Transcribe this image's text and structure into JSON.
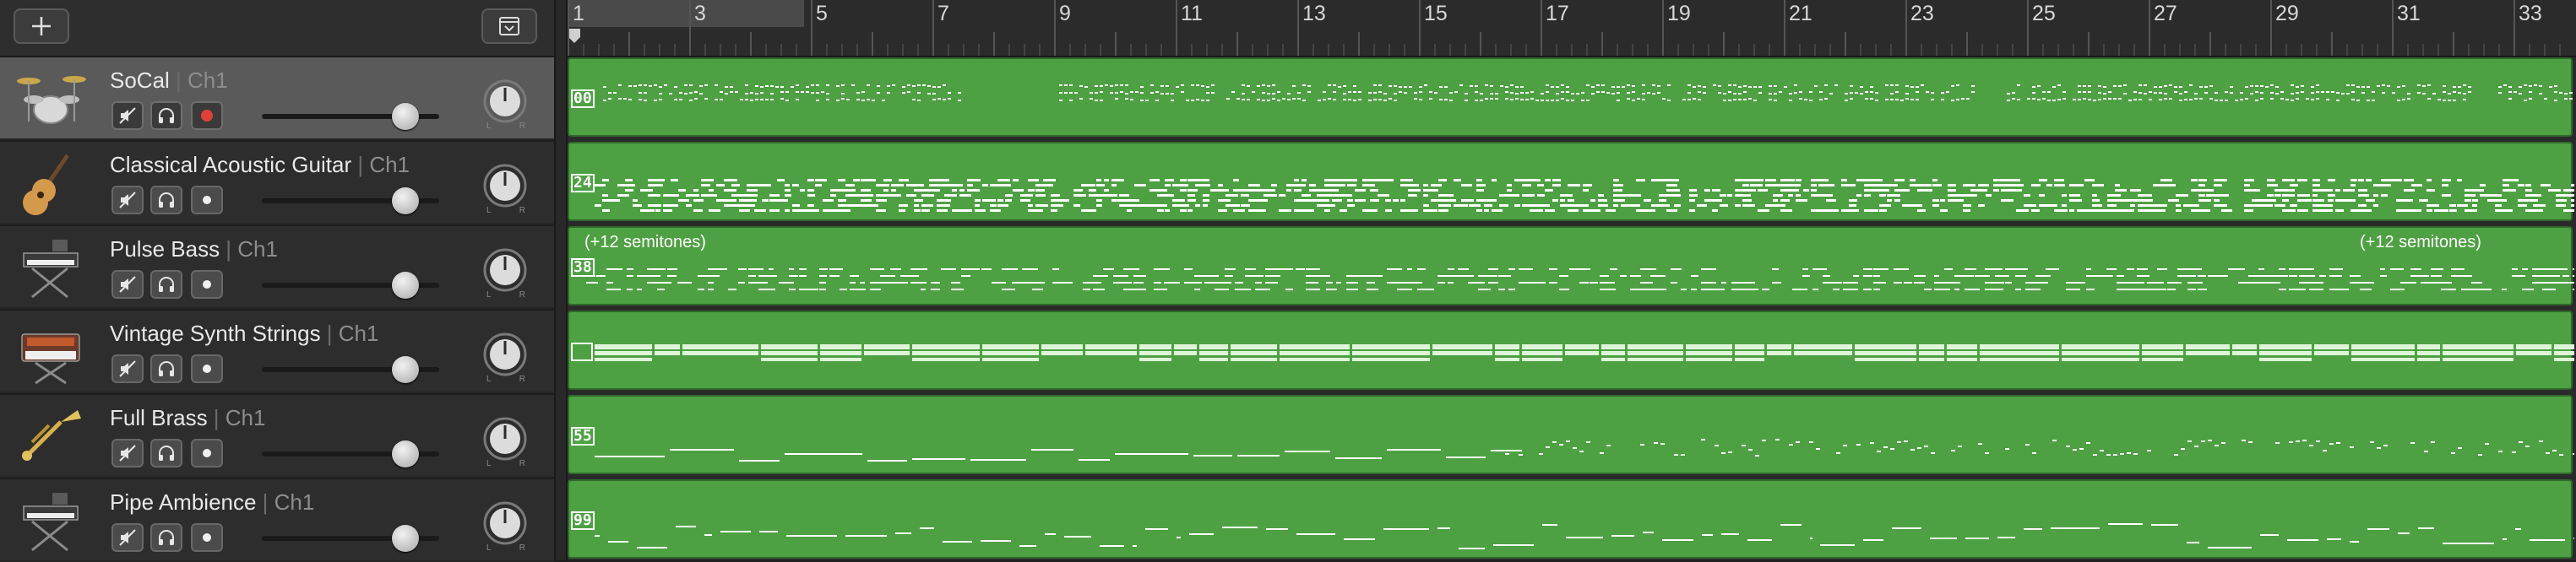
{
  "toolbar": {
    "add_track_icon": "plus-icon",
    "library_icon": "download-box-icon"
  },
  "ruler": {
    "bar_labels": [
      "1",
      "3",
      "5",
      "7",
      "9",
      "11",
      "13",
      "15",
      "17",
      "19",
      "21",
      "23",
      "25",
      "27",
      "29",
      "31",
      "33"
    ]
  },
  "tracks": [
    {
      "name": "SoCal",
      "channel": "Ch1",
      "icon": "drum-kit-icon",
      "selected": true,
      "record_enabled": true,
      "volume_fraction": 0.81,
      "region_id": "00",
      "region_notes": []
    },
    {
      "name": "Classical Acoustic Guitar",
      "channel": "Ch1",
      "icon": "acoustic-guitar-icon",
      "selected": false,
      "record_enabled": false,
      "volume_fraction": 0.81,
      "region_id": "24",
      "region_notes": []
    },
    {
      "name": "Pulse Bass",
      "channel": "Ch1",
      "icon": "keyboard-stand-icon",
      "selected": false,
      "record_enabled": false,
      "volume_fraction": 0.81,
      "region_id": "38",
      "region_notes": [
        "(+12 semitones)",
        "(+12 semitones)"
      ]
    },
    {
      "name": "Vintage Synth Strings",
      "channel": "Ch1",
      "icon": "synthesizer-icon",
      "selected": false,
      "record_enabled": false,
      "volume_fraction": 0.81,
      "region_id": "",
      "region_notes": []
    },
    {
      "name": "Full Brass",
      "channel": "Ch1",
      "icon": "trumpet-icon",
      "selected": false,
      "record_enabled": false,
      "volume_fraction": 0.81,
      "region_id": "55",
      "region_notes": []
    },
    {
      "name": "Pipe Ambience",
      "channel": "Ch1",
      "icon": "keyboard-stand-icon",
      "selected": false,
      "record_enabled": false,
      "volume_fraction": 0.81,
      "region_id": "99",
      "region_notes": []
    }
  ],
  "pan_labels": {
    "left": "L",
    "right": "R"
  },
  "colors": {
    "region": "#4ea143",
    "record": "#e0403a",
    "selected_track": "#5a5a5a"
  }
}
